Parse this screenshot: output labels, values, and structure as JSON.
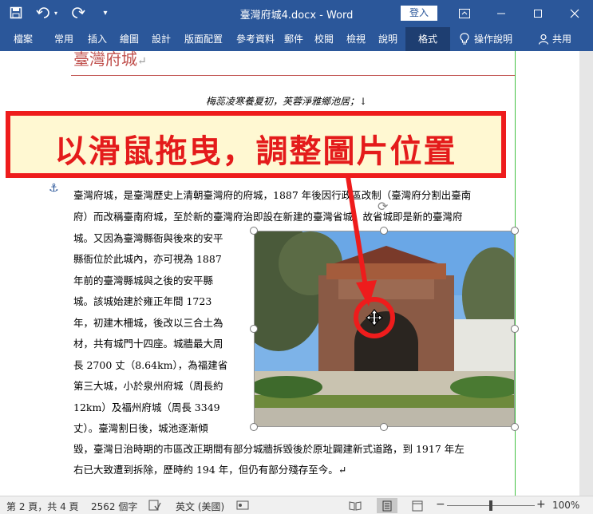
{
  "titlebar": {
    "title": "臺灣府城4.docx - Word",
    "signin": "登入",
    "icons": [
      "save-icon",
      "undo-icon",
      "redo-icon",
      "customize-icon"
    ],
    "window_icons": [
      "ribbon-display-icon",
      "minimize-icon",
      "maximize-icon",
      "close-icon"
    ]
  },
  "ribbon": {
    "tabs": [
      "檔案",
      "常用",
      "插入",
      "繪圖",
      "設計",
      "版面配置",
      "參考資料",
      "郵件",
      "校閱",
      "檢視",
      "說明",
      "格式"
    ],
    "tell_me": "操作說明",
    "share": "共用"
  },
  "document": {
    "heading": "臺灣府城",
    "poem": "梅蕊凌寒養夏初，芙蓉淨雅鄉池居；↓",
    "lines": [
      "臺灣府城，是臺灣歷史上清朝臺灣府的府城，1887 年後因行政區改制（臺灣府分割出臺南",
      "府）而改稱臺南府城，至於新的臺灣府治即設在新建的臺灣省城，故省城即是新的臺灣府",
      "城。又因為臺灣縣衙與後來的安平",
      "縣衙位於此城內，亦可視為 1887",
      "年前的臺灣縣城與之後的安平縣",
      "城。該城始建於雍正年間 1723",
      "年，初建木柵城，後改以三合土為",
      "材，共有城門十四座。城牆最大周",
      "長 2700 丈（8.64km），為福建省",
      "第三大城，小於泉州府城（周長約",
      "12km）及福州府城（周長 3349",
      "丈）。臺灣割日後，城池逐漸傾",
      "毀，臺灣日治時期的市區改正期間有部分城牆拆毀後於原址闢建新式道路，到 1917 年左",
      "右已大致遭到拆除，歷時約 194 年，但仍有部分殘存至今。↵"
    ]
  },
  "callout": {
    "text": "以滑鼠拖曳，調整圖片位置"
  },
  "statusbar": {
    "page": "第 2 頁，共 4 頁",
    "words": "2562 個字",
    "language": "英文 (美國)",
    "zoom_minus": "−",
    "zoom_plus": "+",
    "zoom": "100%",
    "zoom_value": 100
  },
  "colors": {
    "accent": "#2b579a",
    "callout_red": "#e41b1b",
    "callout_bg": "#fff8d2",
    "margin_guide": "#44c244"
  }
}
